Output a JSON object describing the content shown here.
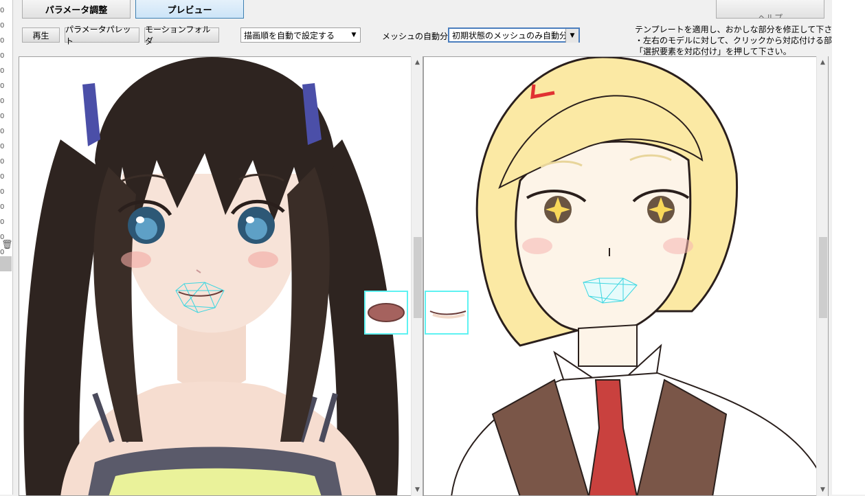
{
  "tabs": [
    {
      "label": "パラメータ調整",
      "active": false
    },
    {
      "label": "プレビュー",
      "active": true
    }
  ],
  "help_button": {
    "label": "ヘルプ"
  },
  "toolbar": {
    "play_label": "再生",
    "param_palette_label": "パラメータパレット",
    "motion_folder_label": "モーションフォルダ",
    "draw_order_select": "描画順を自動で設定する",
    "mesh_label": "メッシュの自動分割",
    "mesh_select": "初期状態のメッシュのみ自動分割"
  },
  "instructions": {
    "line1": "テンプレートを適用し、おかしな部分を修正して下さい。",
    "line2": "・左右のモデルに対して、クリックから対応付ける部位を選び、",
    "line3": "「選択要素を対応付け」を押して下さい。"
  },
  "left_strip_digits": [
    "0",
    "0",
    "0",
    "0",
    "0",
    "0",
    "0",
    "0",
    "0",
    "0",
    "0",
    "0",
    "0",
    "0",
    "0",
    "0",
    "0"
  ],
  "colors": {
    "accent": "#cce4f7",
    "mesh_cyan": "#5ef2f2",
    "hair_dark": "#2e2420",
    "hair_blonde": "#fbe9a4",
    "vest": "#7a5648",
    "tie": "#c9413e"
  },
  "icons": [
    "trash-icon",
    "chevron-up-icon",
    "chevron-down-icon",
    "dropdown-arrow-icon"
  ]
}
